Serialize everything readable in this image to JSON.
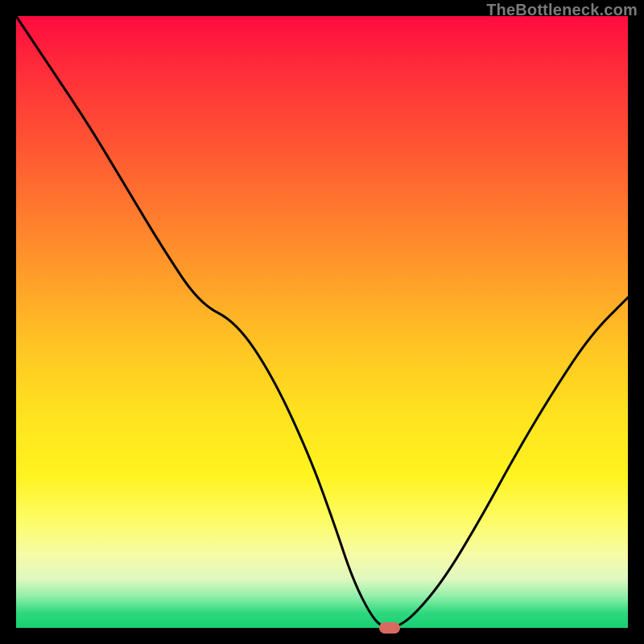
{
  "watermark": "TheBottleneck.com",
  "colors": {
    "frame": "#000000",
    "curve_stroke": "#000000",
    "marker": "#d96a60"
  },
  "chart_data": {
    "type": "line",
    "title": "",
    "xlabel": "",
    "ylabel": "",
    "xlim": [
      0,
      100
    ],
    "ylim": [
      0,
      100
    ],
    "grid": false,
    "legend": false,
    "series": [
      {
        "name": "bottleneck-curve",
        "x": [
          0,
          6,
          12,
          18,
          24,
          30,
          36,
          42,
          48,
          52,
          55,
          58,
          60,
          62,
          65,
          70,
          76,
          82,
          88,
          94,
          100
        ],
        "y": [
          100,
          91,
          82,
          72,
          62,
          53,
          50,
          41,
          28,
          17,
          8,
          2,
          0,
          0,
          2,
          8,
          18,
          29,
          39,
          48,
          54
        ]
      }
    ],
    "marker": {
      "x": 61,
      "y": 0,
      "shape": "pill",
      "color": "#d96a60"
    },
    "gradient_background": {
      "type": "vertical",
      "stops": [
        {
          "pos": 0.0,
          "color": "#ff0b3f"
        },
        {
          "pos": 0.2,
          "color": "#ff5133"
        },
        {
          "pos": 0.45,
          "color": "#ffa628"
        },
        {
          "pos": 0.65,
          "color": "#ffe21f"
        },
        {
          "pos": 0.83,
          "color": "#fdfd6b"
        },
        {
          "pos": 0.95,
          "color": "#8ceea8"
        },
        {
          "pos": 1.0,
          "color": "#17cf73"
        }
      ]
    }
  }
}
